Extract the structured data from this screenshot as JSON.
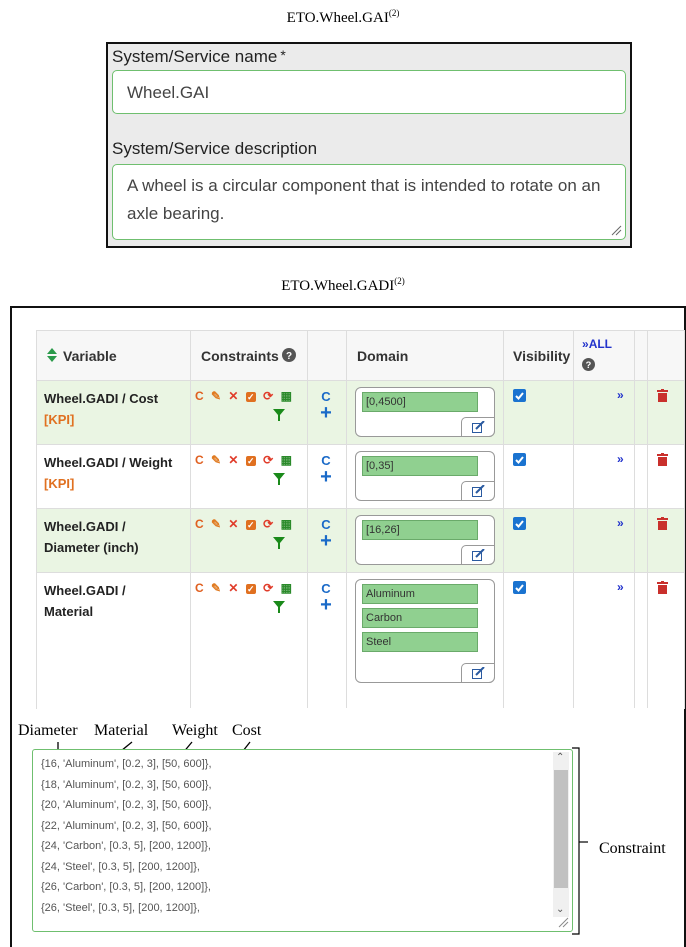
{
  "captions": {
    "gai": "ETO.Wheel.GAI",
    "gai_sup": "(2)",
    "gadi": "ETO.Wheel.GADI",
    "gadi_sup": "(2)"
  },
  "form": {
    "name_label": "System/Service name",
    "name_required": "*",
    "name_value": "Wheel.GAI",
    "desc_label": "System/Service description",
    "desc_value": "A wheel is a circular component that is intended to rotate on an axle bearing."
  },
  "table": {
    "headers": {
      "variable": "Variable",
      "constraints": "Constraints",
      "domain": "Domain",
      "visibility": "Visibility",
      "all": "ALL"
    },
    "rows": [
      {
        "name": "Wheel.GADI / Cost",
        "tag": "[KPI]",
        "domain": [
          "[0,4500]"
        ],
        "visible": true
      },
      {
        "name": "Wheel.GADI / Weight",
        "tag": "[KPI]",
        "domain": [
          "[0,35]"
        ],
        "visible": true
      },
      {
        "name": "Wheel.GADI / Diameter (inch)",
        "tag": "",
        "domain": [
          "[16,26]"
        ],
        "visible": true
      },
      {
        "name": "Wheel.GADI / Material",
        "tag": "",
        "domain": [
          "Aluminum",
          "Carbon",
          "Steel"
        ],
        "visible": true
      }
    ],
    "icon_letter_c": "C"
  },
  "annotations": {
    "diameter": "Diameter",
    "material": "Material",
    "weight": "Weight",
    "cost": "Cost",
    "constraint": "Constraint"
  },
  "constraints": [
    "{16, 'Aluminum', [0.2, 3], [50, 600]},",
    "{18, 'Aluminum', [0.2, 3], [50, 600]},",
    "{20, 'Aluminum', [0.2, 3], [50, 600]},",
    "{22, 'Aluminum', [0.2, 3], [50, 600]},",
    "{24, 'Carbon', [0.3, 5], [200, 1200]},",
    "{24, 'Steel', [0.3, 5], [200, 1200]},",
    "{26, 'Carbon', [0.3, 5], [200, 1200]},",
    "{26, 'Steel', [0.3, 5], [200, 1200]},"
  ],
  "colors": {
    "row_green": "#eaf5e3",
    "accent_blue": "#1a6ac8",
    "kpi_orange": "#e07020",
    "trash_red": "#c9302c",
    "field_border": "#6fbf6f"
  }
}
